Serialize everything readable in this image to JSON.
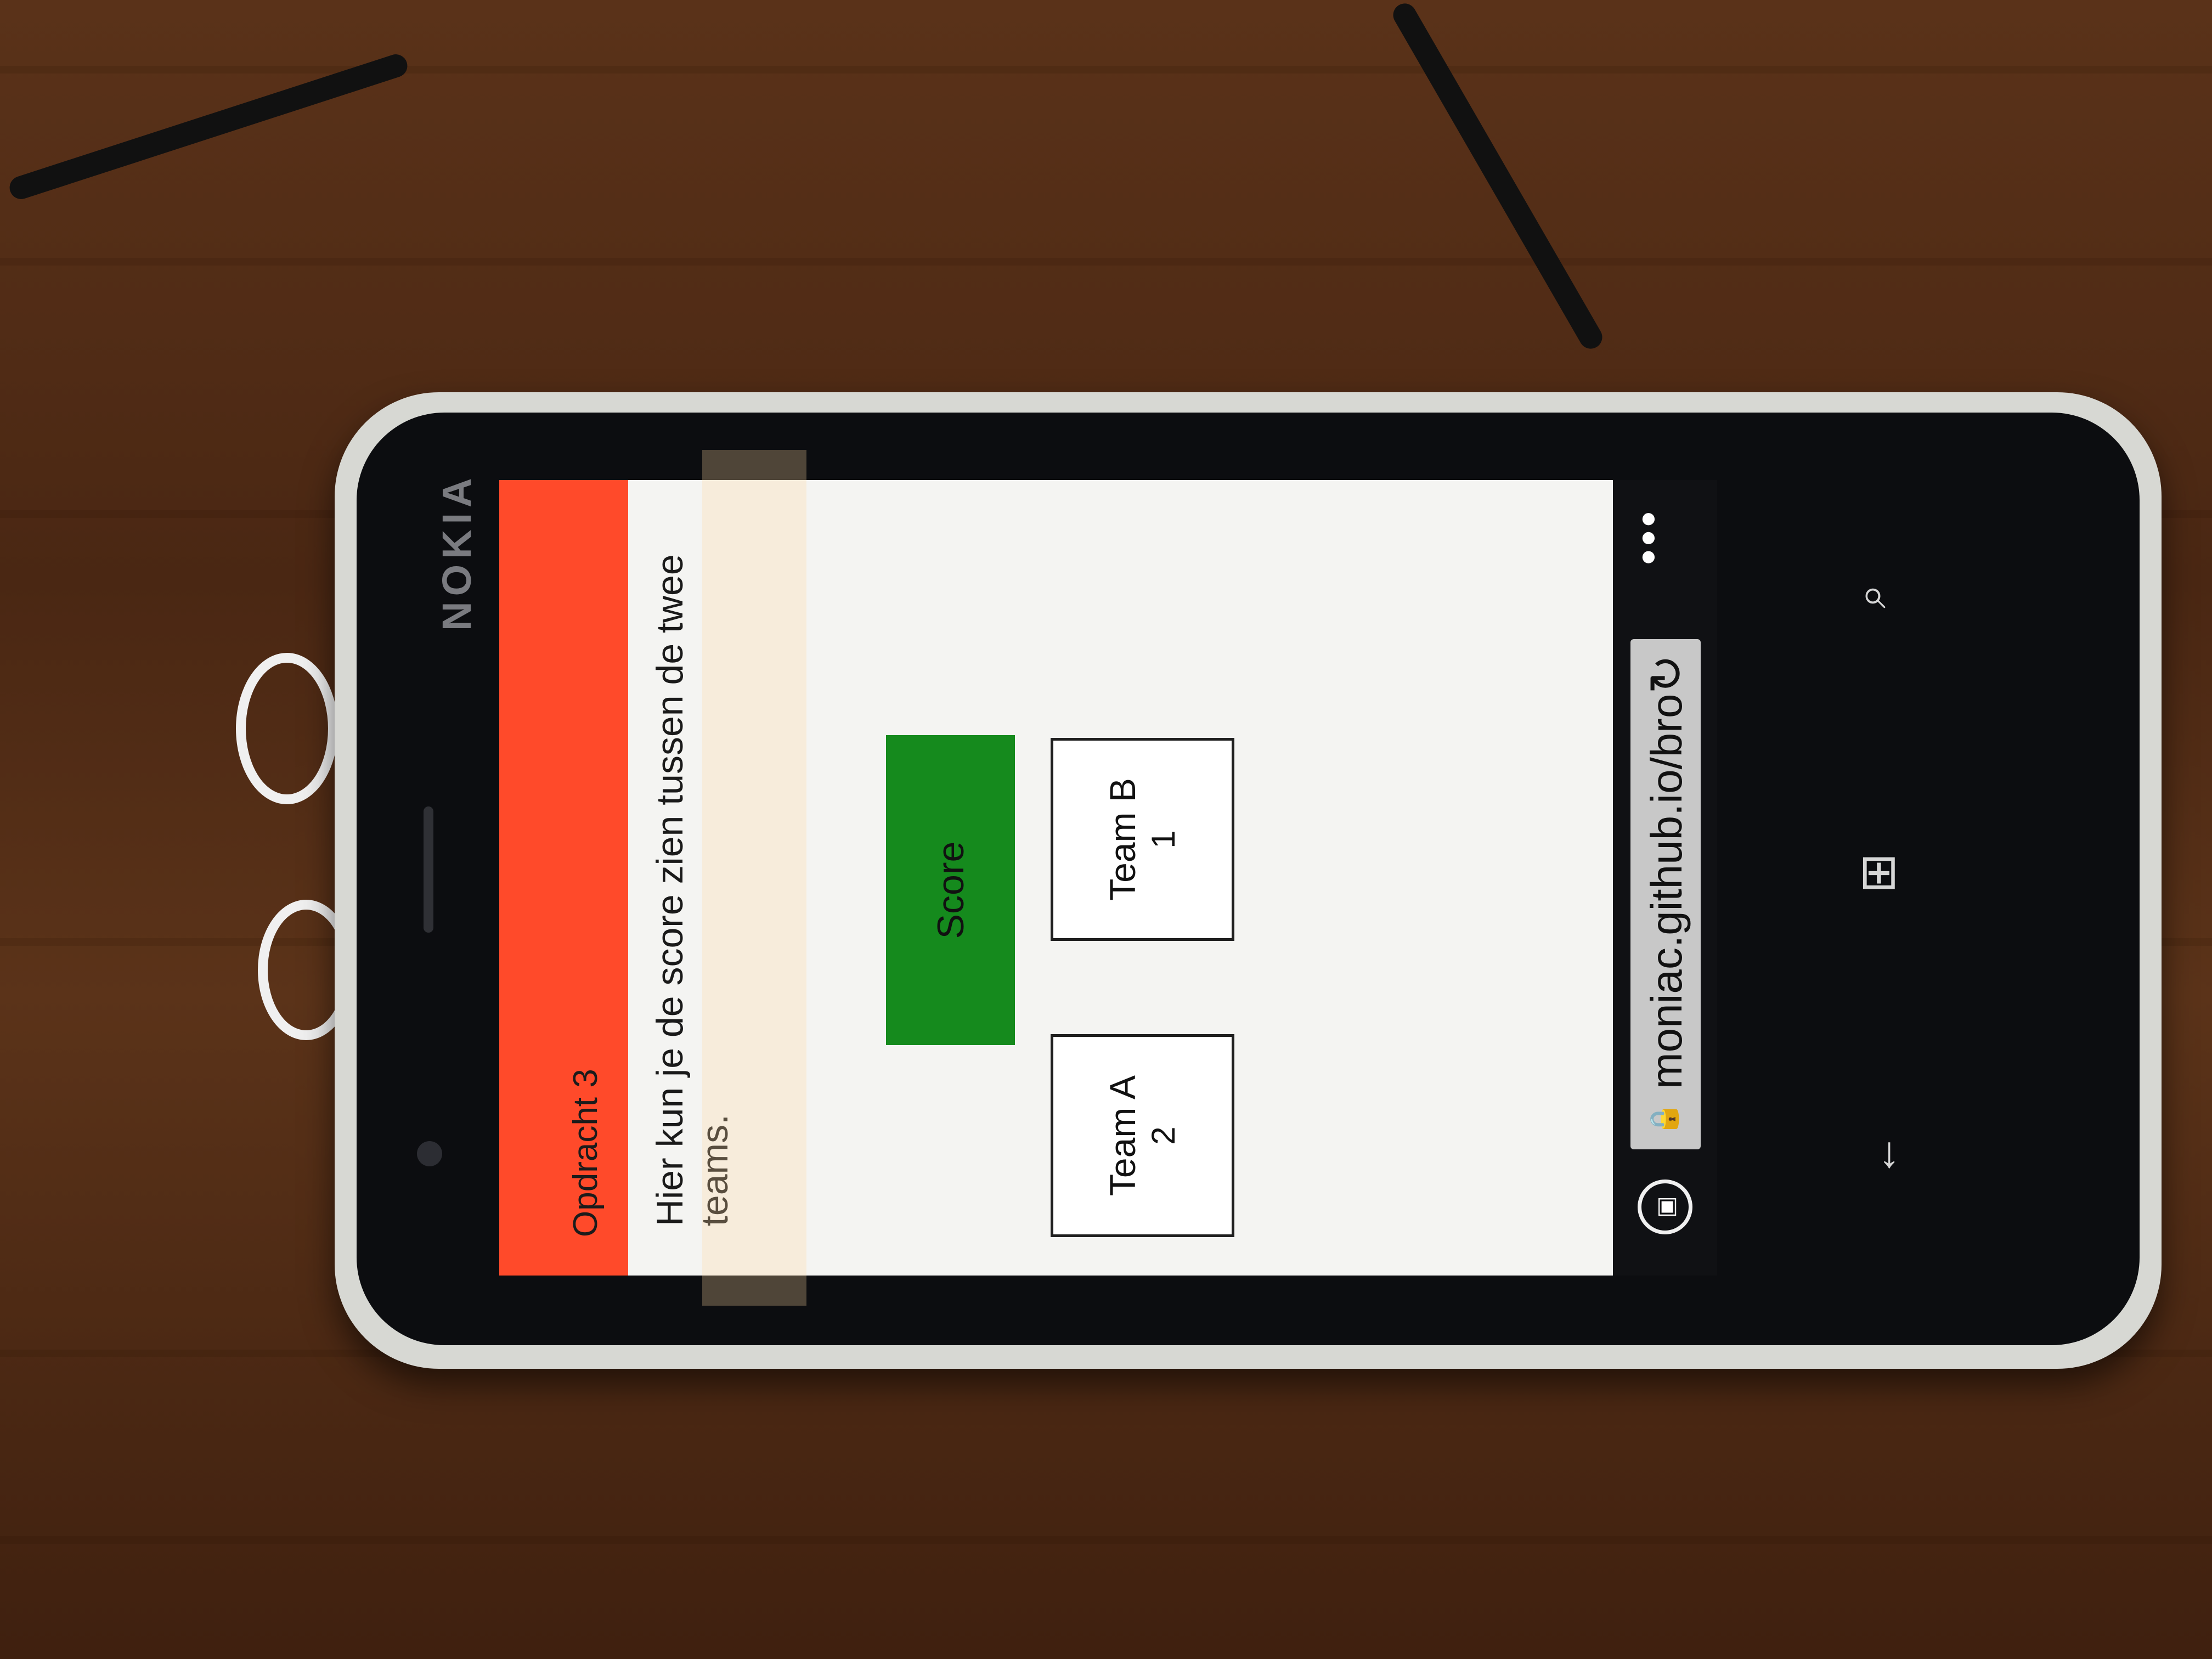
{
  "device": {
    "brand": "NOKIA"
  },
  "app": {
    "header_title": "Opdracht 3",
    "description": "Hier kun je de score zien tussen de twee teams.",
    "score_button_label": "Score",
    "teams": [
      {
        "name": "Team A",
        "score": "2"
      },
      {
        "name": "Team B",
        "score": "1"
      }
    ]
  },
  "browser": {
    "url": "moniac.github.io/bro",
    "icons": [
      "tabs-icon",
      "lock-icon",
      "refresh-icon",
      "more-icon"
    ]
  },
  "system_nav": {
    "icons": [
      "back-icon",
      "windows-start-icon",
      "search-icon"
    ]
  },
  "colors": {
    "header": "#ff4a2a",
    "score_button": "#158a1d",
    "page_background": "#f4f4f2",
    "phone_frame": "#d7d8d3"
  }
}
